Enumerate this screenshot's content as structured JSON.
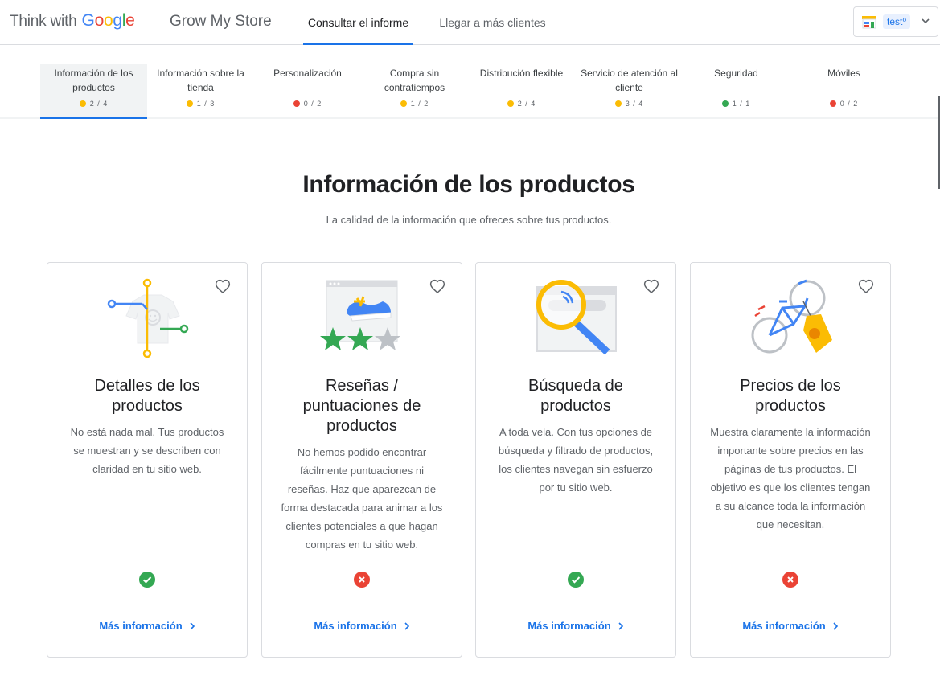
{
  "header": {
    "brand_think": "Think with",
    "brand_google": [
      "G",
      "o",
      "o",
      "g",
      "l",
      "e"
    ],
    "product": "Grow My Store",
    "tabs": [
      {
        "label": "Consultar el informe",
        "active": true
      },
      {
        "label": "Llegar a más clientes",
        "active": false
      }
    ],
    "account": "test⁰"
  },
  "categories": [
    {
      "label": "Información de los productos",
      "score": "2 / 4",
      "status": "yellow",
      "active": true
    },
    {
      "label": "Información sobre la tienda",
      "score": "1 / 3",
      "status": "yellow"
    },
    {
      "label": "Personalización",
      "score": "0 / 2",
      "status": "red"
    },
    {
      "label": "Compra sin contratiempos",
      "score": "1 / 2",
      "status": "yellow"
    },
    {
      "label": "Distribución flexible",
      "score": "2 / 4",
      "status": "yellow"
    },
    {
      "label": "Servicio de atención al cliente",
      "score": "3 / 4",
      "status": "yellow"
    },
    {
      "label": "Seguridad",
      "score": "1 / 1",
      "status": "green"
    },
    {
      "label": "Móviles",
      "score": "0 / 2",
      "status": "red"
    }
  ],
  "colors": {
    "yellow": "#fbbc04",
    "red": "#ea4335",
    "green": "#34a853",
    "blue": "#1a73e8"
  },
  "section": {
    "title": "Información de los productos",
    "subtitle": "La calidad de la información que ofreces sobre tus productos."
  },
  "cards": [
    {
      "title": "Detalles de los productos",
      "description": "No está nada mal. Tus productos se muestran y se describen con claridad en tu sitio web.",
      "status": "pass",
      "icon": "tshirt-illustration",
      "more": "Más información"
    },
    {
      "title": "Reseñas / puntuaciones de productos",
      "description": "No hemos podido encontrar fácilmente puntuaciones ni reseñas. Haz que aparezcan de forma destacada para animar a los clientes potenciales a que hagan compras en tu sitio web.",
      "status": "fail",
      "icon": "shoe-stars-illustration",
      "more": "Más información"
    },
    {
      "title": "Búsqueda de productos",
      "description": "A toda vela. Con tus opciones de búsqueda y filtrado de productos, los clientes navegan sin esfuerzo por tu sitio web.",
      "status": "pass",
      "icon": "magnifier-illustration",
      "more": "Más información"
    },
    {
      "title": "Precios de los productos",
      "description": "Muestra claramente la información importante sobre precios en las páginas de tus productos. El objetivo es que los clientes tengan a su alcance toda la información que necesitan.",
      "status": "fail",
      "icon": "bicycle-tag-illustration",
      "more": "Más información"
    }
  ]
}
